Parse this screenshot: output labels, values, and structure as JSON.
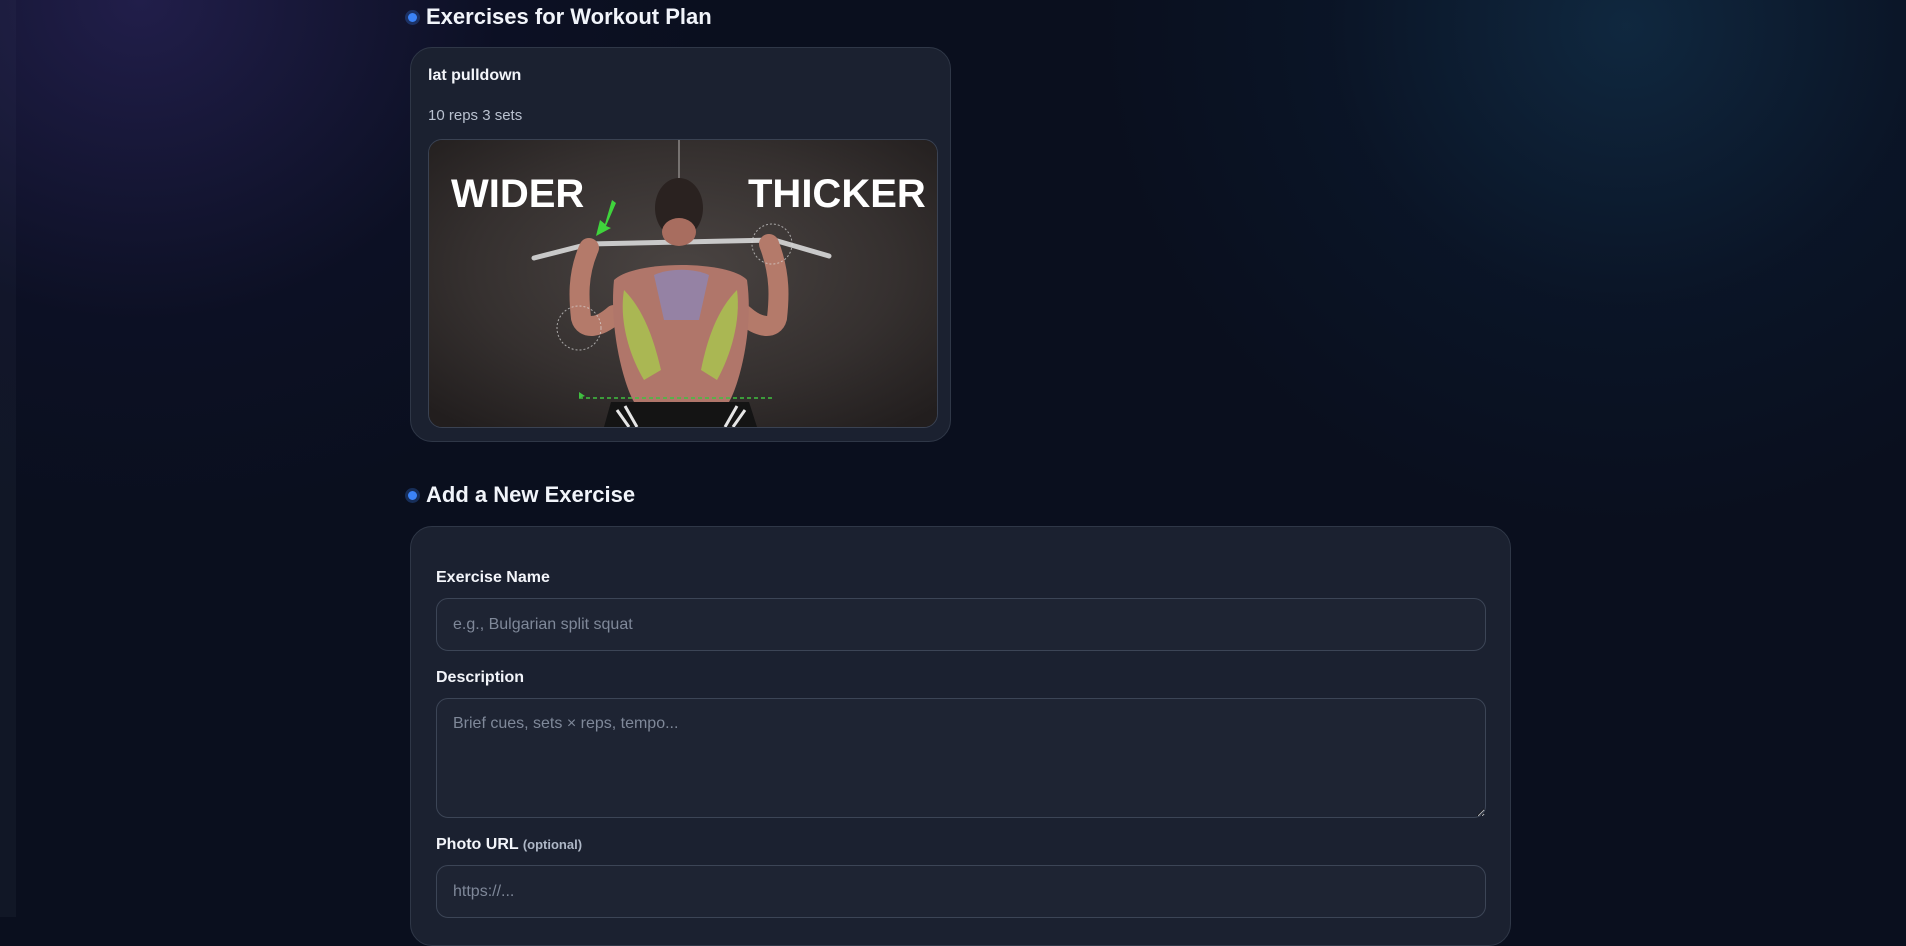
{
  "workout_section": {
    "title": "Exercises for Workout Plan"
  },
  "exercises": [
    {
      "name": "lat pulldown",
      "meta": "10 reps 3 sets",
      "photo_text_left": "WIDER",
      "photo_text_right": "THICKER"
    }
  ],
  "add_section": {
    "title": "Add a New Exercise",
    "name_label": "Exercise Name",
    "name_placeholder": "e.g., Bulgarian split squat",
    "description_label": "Description",
    "description_placeholder": "Brief cues, sets × reps, tempo...",
    "photo_label": "Photo URL",
    "photo_optional": "(optional)",
    "photo_placeholder": "https://..."
  },
  "colors": {
    "accent": "#3b82f6",
    "card_bg": "#1b2130",
    "page_bg": "#0a0f1e"
  }
}
